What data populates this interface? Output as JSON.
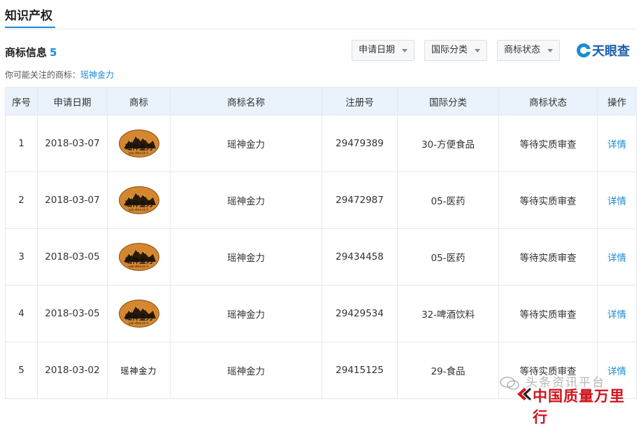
{
  "tabs": {
    "active": "知识产权"
  },
  "section": {
    "title": "商标信息",
    "count": "5"
  },
  "filters": [
    {
      "label": "申请日期"
    },
    {
      "label": "国际分类"
    },
    {
      "label": "商标状态"
    }
  ],
  "brand": {
    "name": "天眼查"
  },
  "hint": {
    "prefix": "你可能关注的商标：",
    "link": "瑶神金力"
  },
  "table": {
    "headers": [
      "序号",
      "申请日期",
      "商标",
      "商标名称",
      "注册号",
      "国际分类",
      "商标状态",
      "操作"
    ],
    "rows": [
      {
        "index": "1",
        "date": "2018-03-07",
        "logo": "oval",
        "name": "瑶神金力",
        "reg": "29479389",
        "cls": "30-方便食品",
        "status": "等待实质审查",
        "action": "详情"
      },
      {
        "index": "2",
        "date": "2018-03-07",
        "logo": "oval",
        "name": "瑶神金力",
        "reg": "29472987",
        "cls": "05-医药",
        "status": "等待实质审查",
        "action": "详情"
      },
      {
        "index": "3",
        "date": "2018-03-05",
        "logo": "oval",
        "name": "瑶神金力",
        "reg": "29434458",
        "cls": "05-医药",
        "status": "等待实质审查",
        "action": "详情"
      },
      {
        "index": "4",
        "date": "2018-03-05",
        "logo": "oval",
        "name": "瑶神金力",
        "reg": "29429534",
        "cls": "32-啤酒饮料",
        "status": "等待实质审查",
        "action": "详情"
      },
      {
        "index": "5",
        "date": "2018-03-02",
        "logo": "text",
        "logo_text": "瑶神金力",
        "name": "瑶神金力",
        "reg": "29415125",
        "cls": "29-食品",
        "status": "等待实质审查",
        "action": "详情"
      }
    ]
  },
  "watermark": {
    "line1": "头条资讯平台",
    "line2": "中国质量万里行"
  }
}
